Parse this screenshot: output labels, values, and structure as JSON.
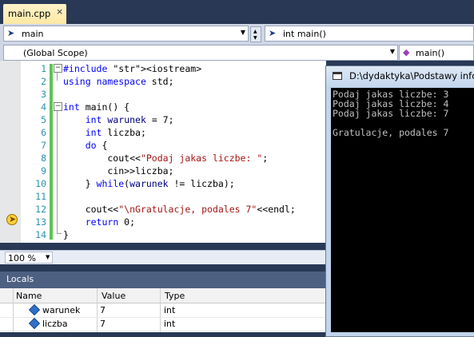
{
  "tab": {
    "label": "main.cpp",
    "close": "×"
  },
  "nav": {
    "file_scope": "main",
    "member": "int main()",
    "scope": "(Global Scope)",
    "member2": "main()"
  },
  "editor": {
    "line_numbers": [
      "1",
      "2",
      "3",
      "4",
      "5",
      "6",
      "7",
      "8",
      "9",
      "10",
      "11",
      "12",
      "13",
      "14"
    ],
    "lines": [
      [
        "#include <iostream>"
      ],
      [
        "using namespace std;"
      ],
      [
        ""
      ],
      [
        "int main() {"
      ],
      [
        "    int warunek = 7;"
      ],
      [
        "    int liczba;"
      ],
      [
        "    do {"
      ],
      [
        "        cout<<\"Podaj jakas liczbe: \";"
      ],
      [
        "        cin>>liczba;"
      ],
      [
        "    } while(warunek != liczba);"
      ],
      [
        ""
      ],
      [
        "    cout<<\"\\nGratulacje, podales 7\"<<endl;"
      ],
      [
        "    return 0;"
      ],
      [
        "}"
      ]
    ]
  },
  "zoom": "100 %",
  "locals": {
    "title": "Locals",
    "headers": {
      "name": "Name",
      "value": "Value",
      "type": "Type"
    },
    "rows": [
      {
        "name": "warunek",
        "value": "7",
        "type": "int"
      },
      {
        "name": "liczba",
        "value": "7",
        "type": "int"
      }
    ]
  },
  "console": {
    "title": "D:\\dydaktyka\\Podstawy infor",
    "lines": [
      "Podaj jakas liczbe: 3",
      "Podaj jakas liczbe: 4",
      "Podaj jakas liczbe: 7",
      "",
      "Gratulacje, podales 7"
    ]
  },
  "icons": {
    "file": "file-icon",
    "method": "method-icon",
    "breakpoint_arrow": "current-statement-arrow-icon",
    "variable": "variable-icon"
  }
}
